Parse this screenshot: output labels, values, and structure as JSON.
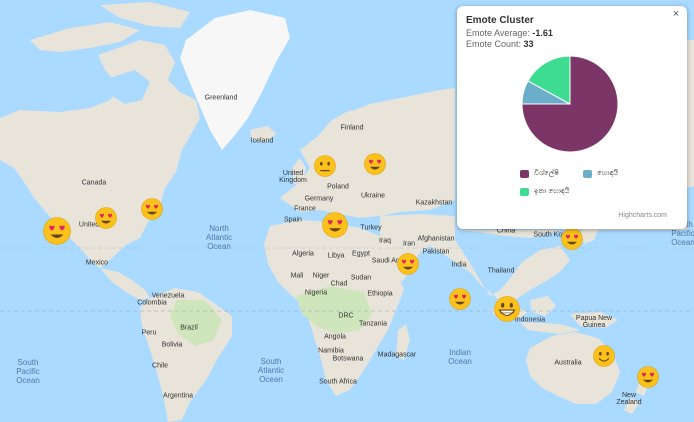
{
  "colors": {
    "water": "#aadaff",
    "land": "#e8e4d9",
    "ice": "#f7f7f7",
    "green": "#cfe6bd"
  },
  "map_labels": [
    {
      "id": "greenland",
      "text": "Greenland"
    },
    {
      "id": "iceland",
      "text": "Iceland"
    },
    {
      "id": "finland",
      "text": "Finland"
    },
    {
      "id": "canada",
      "text": "Canada"
    },
    {
      "id": "uk",
      "text": "United\nKingdom"
    },
    {
      "id": "poland",
      "text": "Poland"
    },
    {
      "id": "germany",
      "text": "Germany"
    },
    {
      "id": "france",
      "text": "France"
    },
    {
      "id": "spain",
      "text": "Spain"
    },
    {
      "id": "ukraine",
      "text": "Ukraine"
    },
    {
      "id": "kazakhstan",
      "text": "Kazakhstan"
    },
    {
      "id": "turkey",
      "text": "Turkey"
    },
    {
      "id": "iran",
      "text": "Iran"
    },
    {
      "id": "afghanistan",
      "text": "Afghanistan"
    },
    {
      "id": "pakistan",
      "text": "Pakistan"
    },
    {
      "id": "china",
      "text": "China"
    },
    {
      "id": "south_korea",
      "text": "South Kor"
    },
    {
      "id": "us",
      "text": "United"
    },
    {
      "id": "mexico",
      "text": "Mexico"
    },
    {
      "id": "algeria",
      "text": "Algeria"
    },
    {
      "id": "libya",
      "text": "Libya"
    },
    {
      "id": "egypt",
      "text": "Egypt"
    },
    {
      "id": "mali",
      "text": "Mali"
    },
    {
      "id": "niger",
      "text": "Niger"
    },
    {
      "id": "chad",
      "text": "Chad"
    },
    {
      "id": "sudan",
      "text": "Sudan"
    },
    {
      "id": "iraq",
      "text": "Iraq"
    },
    {
      "id": "saudi",
      "text": "Saudi Ar"
    },
    {
      "id": "india",
      "text": "India"
    },
    {
      "id": "thailand",
      "text": "Thailand"
    },
    {
      "id": "ethiopia",
      "text": "Ethiopia"
    },
    {
      "id": "nigeria",
      "text": "Nigeria"
    },
    {
      "id": "drc",
      "text": "DRC"
    },
    {
      "id": "tanzania",
      "text": "Tanzania"
    },
    {
      "id": "angola",
      "text": "Angola"
    },
    {
      "id": "namibia",
      "text": "Namibia"
    },
    {
      "id": "botswana",
      "text": "Botswana"
    },
    {
      "id": "madagascar",
      "text": "Madagascar"
    },
    {
      "id": "south_africa",
      "text": "South Africa"
    },
    {
      "id": "venezuela",
      "text": "Venezuela"
    },
    {
      "id": "colombia",
      "text": "Colombia"
    },
    {
      "id": "peru",
      "text": "Peru"
    },
    {
      "id": "brazil",
      "text": "Brazil"
    },
    {
      "id": "bolivia",
      "text": "Bolivia"
    },
    {
      "id": "chile",
      "text": "Chile"
    },
    {
      "id": "argentina",
      "text": "Argentina"
    },
    {
      "id": "indonesia",
      "text": "Indonesia"
    },
    {
      "id": "png",
      "text": "Papua New\nGuinea"
    },
    {
      "id": "australia",
      "text": "Australia"
    },
    {
      "id": "new_zealand",
      "text": "New\nZealand"
    }
  ],
  "ocean_labels": [
    {
      "id": "north_atlantic",
      "text": "North\nAtlantic\nOcean"
    },
    {
      "id": "south_atlantic",
      "text": "South\nAtlantic\nOcean"
    },
    {
      "id": "south_pacific",
      "text": "South\nPacific\nOcean"
    },
    {
      "id": "indian",
      "text": "Indian\nOcean"
    },
    {
      "id": "north_pacific_edge",
      "text": "North\nPacific\nOcean"
    }
  ],
  "emotes": [
    {
      "id": "sweden",
      "type": "neutral"
    },
    {
      "id": "russia",
      "type": "heart-eyes"
    },
    {
      "id": "us_central",
      "type": "heart-eyes"
    },
    {
      "id": "us_east",
      "type": "heart-eyes"
    },
    {
      "id": "us_west",
      "type": "heart-eyes"
    },
    {
      "id": "mediterranean",
      "type": "heart-eyes"
    },
    {
      "id": "arabian",
      "type": "heart-eyes"
    },
    {
      "id": "indian_ocean",
      "type": "heart-eyes"
    },
    {
      "id": "southeast_asia",
      "type": "grin"
    },
    {
      "id": "japan",
      "type": "heart-eyes"
    },
    {
      "id": "australia_east",
      "type": "smile"
    },
    {
      "id": "new_zealand",
      "type": "heart-eyes"
    }
  ],
  "popup": {
    "close_label": "×",
    "title": "Emote Cluster",
    "average_label": "Emote Average:",
    "average_value": "-1.61",
    "count_label": "Emote Count:",
    "count_value": "33",
    "credits": "Highcharts.com"
  },
  "chart_data": {
    "type": "pie",
    "title": "",
    "series": [
      {
        "name": "",
        "data": [
          {
            "name": "විශ්ලේෂී",
            "value": 75,
            "color": "#7b3567"
          },
          {
            "name": "හොඳයි",
            "value": 8,
            "color": "#6cadc9"
          },
          {
            "name": "ඉතා හොඳයි",
            "value": 17,
            "color": "#3ddc91"
          }
        ]
      }
    ],
    "legend_position": "bottom"
  }
}
